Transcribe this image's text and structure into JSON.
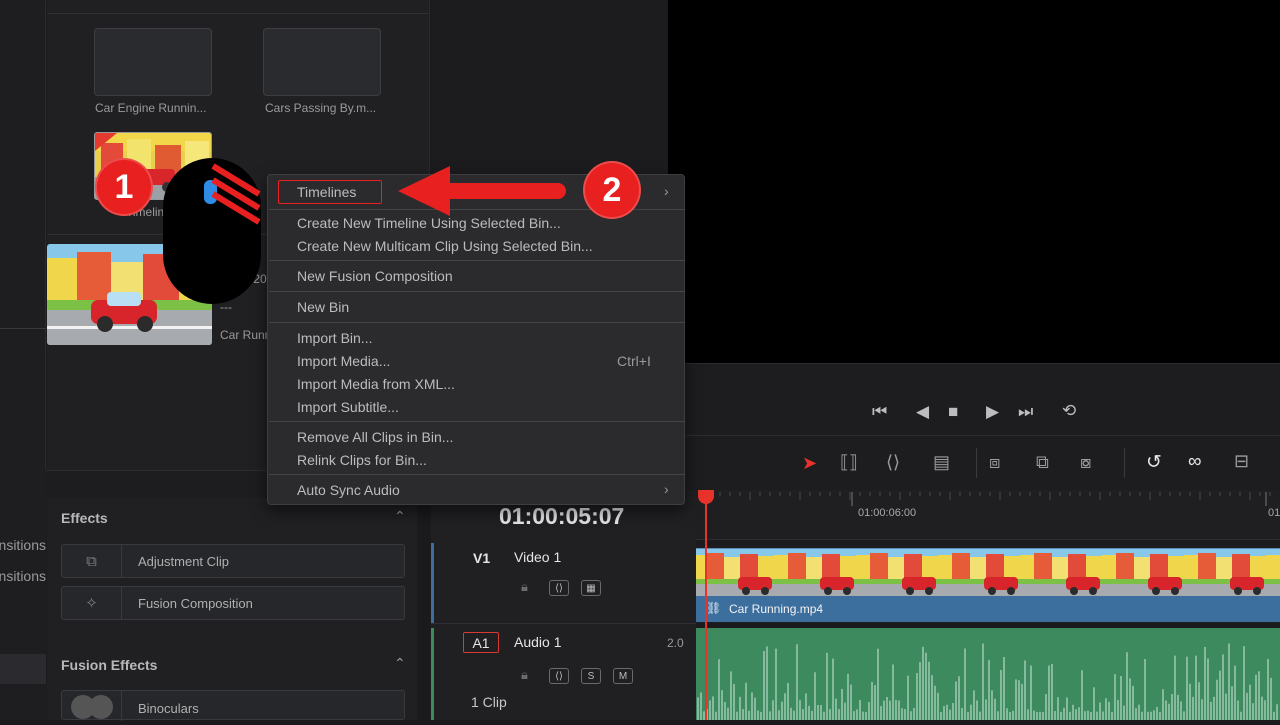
{
  "media_pool": {
    "clips": [
      {
        "label": "Car Engine Runnin..."
      },
      {
        "label": "Cars Passing By.m..."
      },
      {
        "label": "Timeline 1"
      },
      {
        "label": "Car Running.mp4",
        "duration": "00:00:20:00",
        "meta": "---"
      }
    ]
  },
  "effects": {
    "left_items": [
      "Transitions",
      "Transitions"
    ],
    "section_effects": "Effects",
    "items": [
      {
        "label": "Adjustment Clip",
        "icon": "adjustment-clip-icon"
      },
      {
        "label": "Fusion Composition",
        "icon": "fusion-wand-icon"
      }
    ],
    "section_fusion": "Fusion Effects",
    "fusion_items": [
      {
        "label": "Binoculars",
        "icon": "binoculars-icon"
      }
    ]
  },
  "timeline": {
    "timecode": "01:00:05:07",
    "ruler_label": "01:00:06:00",
    "ruler_label_right": "01",
    "video_track": {
      "id": "V1",
      "name": "Video 1",
      "clip_name": "Car Running.mp4"
    },
    "audio_track": {
      "id": "A1",
      "name": "Audio 1",
      "channels": "2.0",
      "clip_count": "1 Clip",
      "solo": "S",
      "mute": "M"
    }
  },
  "context_menu": {
    "items": [
      {
        "label": "Timelines",
        "submenu": true,
        "highlighted": true
      },
      {
        "label": "Create New Timeline Using Selected Bin..."
      },
      {
        "label": "Create New Multicam Clip Using Selected Bin..."
      },
      {
        "label": "New Fusion Composition"
      },
      {
        "label": "New Bin"
      },
      {
        "label": "Import Bin..."
      },
      {
        "label": "Import Media...",
        "shortcut": "Ctrl+I"
      },
      {
        "label": "Import Media from XML..."
      },
      {
        "label": "Import Subtitle..."
      },
      {
        "label": "Remove All Clips in Bin..."
      },
      {
        "label": "Relink Clips for Bin..."
      },
      {
        "label": "Auto Sync Audio",
        "submenu": true
      }
    ]
  },
  "annotations": {
    "badge1": "1",
    "badge2": "2",
    "accent": "#e8201f"
  },
  "colors": {
    "audio_green": "#3d8a5e",
    "video_blue": "#3c6e9e",
    "playhead": "#e8332b"
  }
}
